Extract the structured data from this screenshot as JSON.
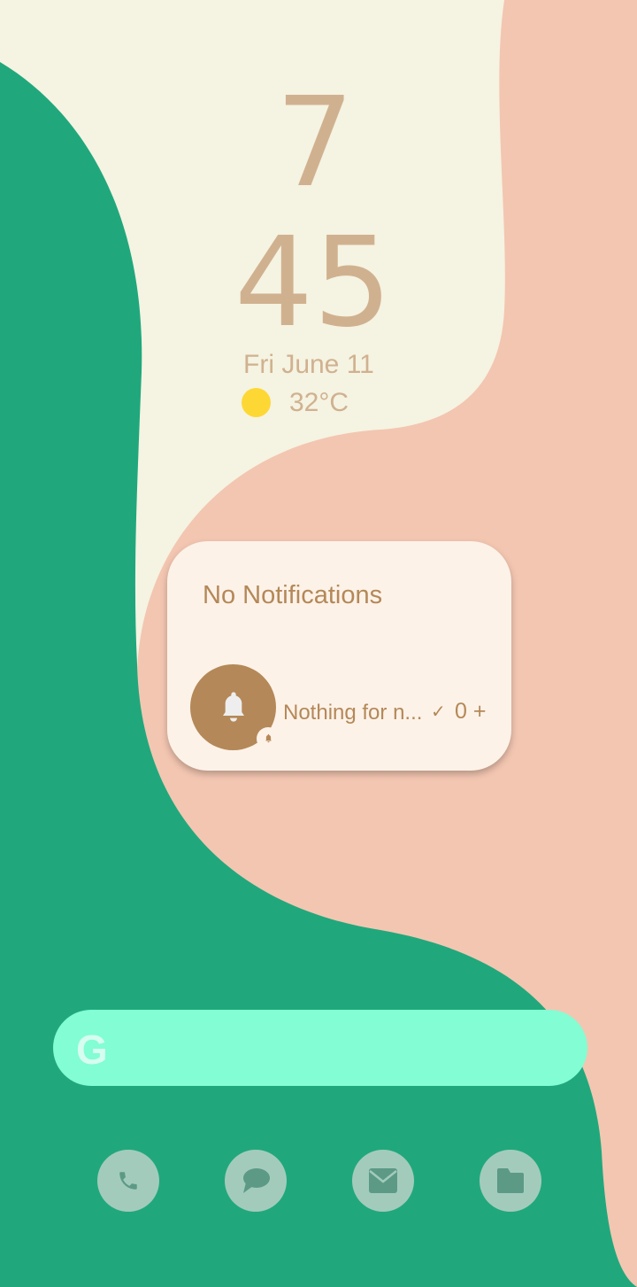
{
  "clock": {
    "hour": "7",
    "minute": "45",
    "date": "Fri June 11",
    "temperature": "32°C",
    "weather_icon": "sun-icon"
  },
  "notification_widget": {
    "title": "No Notifications",
    "summary": "Nothing for n...",
    "check": "✓",
    "count": "0",
    "add": "+"
  },
  "search": {
    "logo": "G"
  },
  "dock": [
    {
      "name": "phone-icon"
    },
    {
      "name": "messages-icon"
    },
    {
      "name": "email-icon"
    },
    {
      "name": "files-icon"
    }
  ],
  "colors": {
    "cream": "#f5f3e2",
    "green": "#20a87c",
    "pink": "#f3c6b1",
    "accent": "#b48858",
    "search": "#82fdd4"
  }
}
